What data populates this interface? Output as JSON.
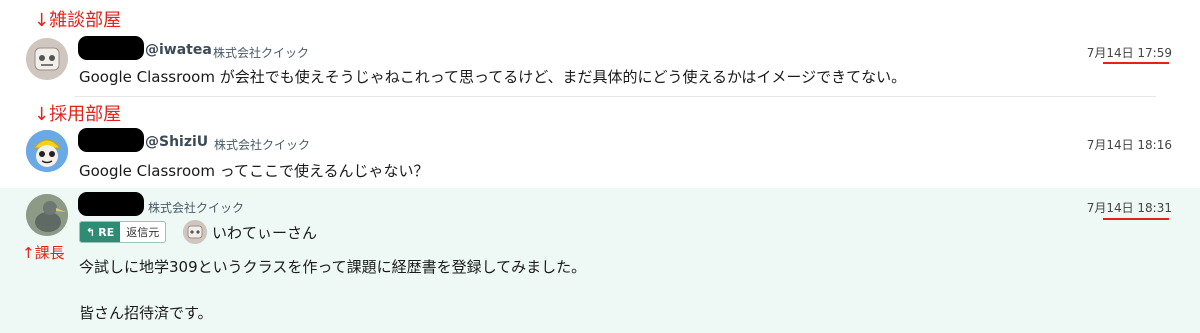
{
  "annotations": {
    "zatsudan": "↓雑談部屋",
    "saiyou": "↓採用部屋",
    "kachou": "↑課長"
  },
  "messages": [
    {
      "handle": "@iwatea",
      "company": "株式会社クイック",
      "time": "7月14日 17:59",
      "text": "Google Classroom が会社でも使えそうじゃねこれって思ってるけど、まだ具体的にどう使えるかはイメージできてない。"
    },
    {
      "handle": "@ShiziU",
      "company": "株式会社クイック",
      "time": "7月14日 18:16",
      "text": "Google Classroom ってここで使えるんじゃない？"
    },
    {
      "handle": "",
      "company": "株式会社クイック",
      "time": "7月14日 18:31",
      "reply_tag": "RE",
      "reply_source_label": "返信元",
      "reply_to_name": "いわてぃーさん",
      "text_line1": "今試しに地学309というクラスを作って課題に経歴書を登録してみました。",
      "text_line2": "皆さん招待済です。"
    }
  ],
  "colors": {
    "annotation": "#e0241b",
    "reply_tag": "#2e8b74",
    "highlight_bg": "#eef9f6"
  }
}
